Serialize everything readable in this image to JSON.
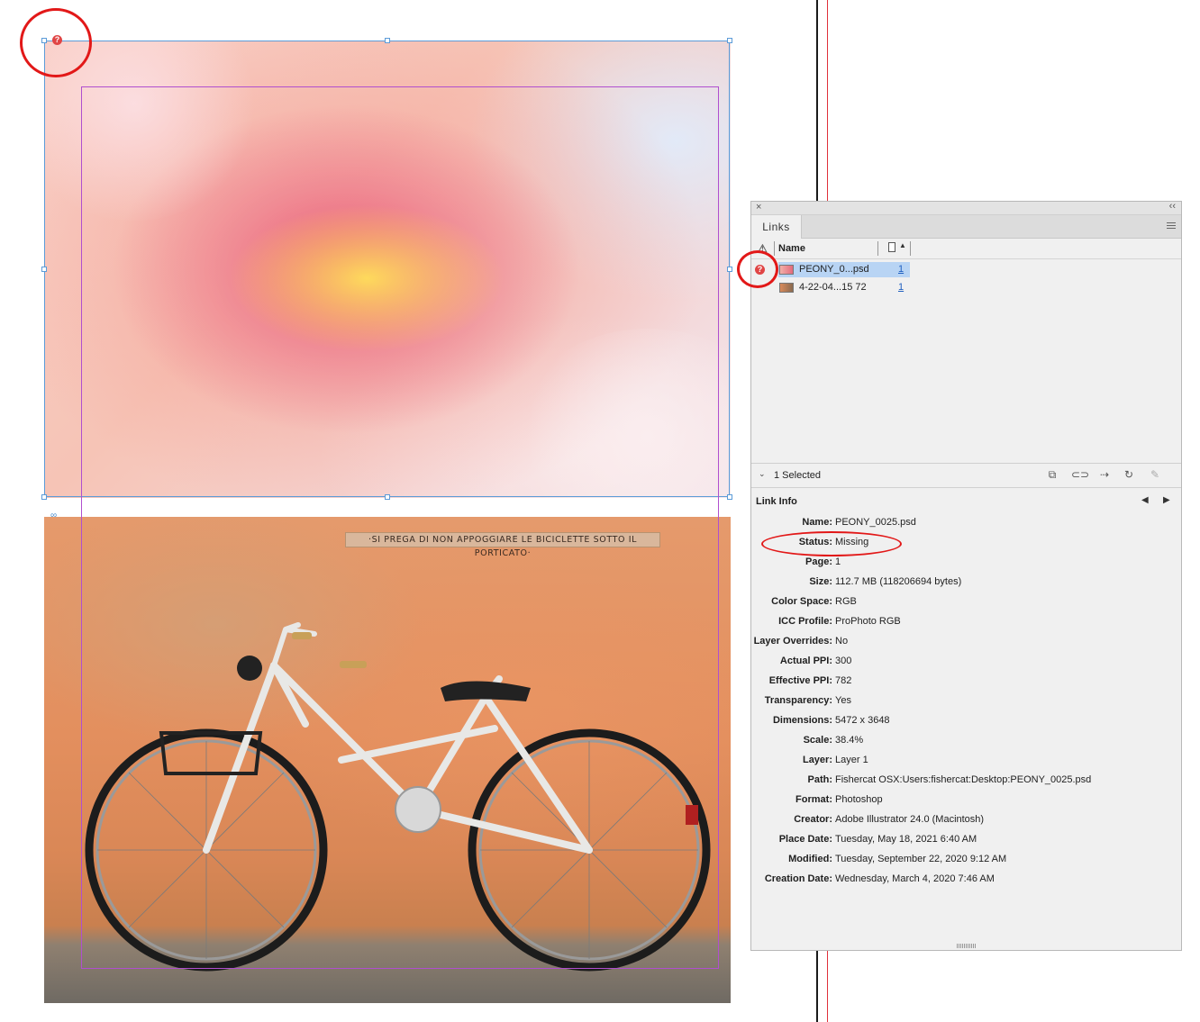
{
  "canvas": {
    "peony_image_alt": "Peony flower close-up",
    "bike_image_alt": "Bicycle leaning against orange wall",
    "bike_sign_text": "·SI PREGA DI NON APPOGGIARE LE BICICLETTE SOTTO IL PORTICATO·",
    "missing_badge": "?"
  },
  "panel": {
    "close_glyph": "×",
    "collapse_glyph": "‹‹",
    "tab_label": "Links",
    "columns": {
      "warning_glyph": "⚠",
      "name": "Name"
    },
    "links": [
      {
        "name": "PEONY_0...psd",
        "page": "1",
        "status": "missing",
        "selected": true
      },
      {
        "name": "4-22-04...15 72",
        "page": "1",
        "status": "ok",
        "selected": false
      }
    ],
    "selection_label": "1 Selected",
    "toolbar_icons": [
      "relink-cc-icon",
      "relink-icon",
      "goto-link-icon",
      "update-link-icon",
      "edit-original-icon"
    ],
    "link_info_title": "Link Info",
    "link_info": [
      {
        "label": "Name:",
        "value": "PEONY_0025.psd"
      },
      {
        "label": "Status:",
        "value": "Missing"
      },
      {
        "label": "Page:",
        "value": "1"
      },
      {
        "label": "Size:",
        "value": "112.7 MB (118206694 bytes)"
      },
      {
        "label": "Color Space:",
        "value": "RGB"
      },
      {
        "label": "ICC Profile:",
        "value": "ProPhoto RGB"
      },
      {
        "label": "Layer Overrides:",
        "value": "No"
      },
      {
        "label": "Actual PPI:",
        "value": "300"
      },
      {
        "label": "Effective PPI:",
        "value": "782"
      },
      {
        "label": "Transparency:",
        "value": "Yes"
      },
      {
        "label": "Dimensions:",
        "value": "5472 x 3648"
      },
      {
        "label": "Scale:",
        "value": "38.4%"
      },
      {
        "label": "Layer:",
        "value": "Layer 1"
      },
      {
        "label": "Path:",
        "value": "Fishercat OSX:Users:fishercat:Desktop:PEONY_0025.psd"
      },
      {
        "label": "Format:",
        "value": "Photoshop"
      },
      {
        "label": "Creator:",
        "value": "Adobe Illustrator 24.0 (Macintosh)"
      },
      {
        "label": "Place Date:",
        "value": "Tuesday, May 18, 2021 6:40 AM"
      },
      {
        "label": "Modified:",
        "value": "Tuesday, September 22, 2020 9:12 AM"
      },
      {
        "label": "Creation Date:",
        "value": "Wednesday, March 4, 2020 7:46 AM"
      }
    ]
  },
  "colors": {
    "missing_red": "#e04545",
    "annotation_red": "#e21818",
    "selection_blue": "#b8d4f4",
    "frame_blue": "#5b9bd8",
    "margin_purple": "#b04fcf"
  }
}
